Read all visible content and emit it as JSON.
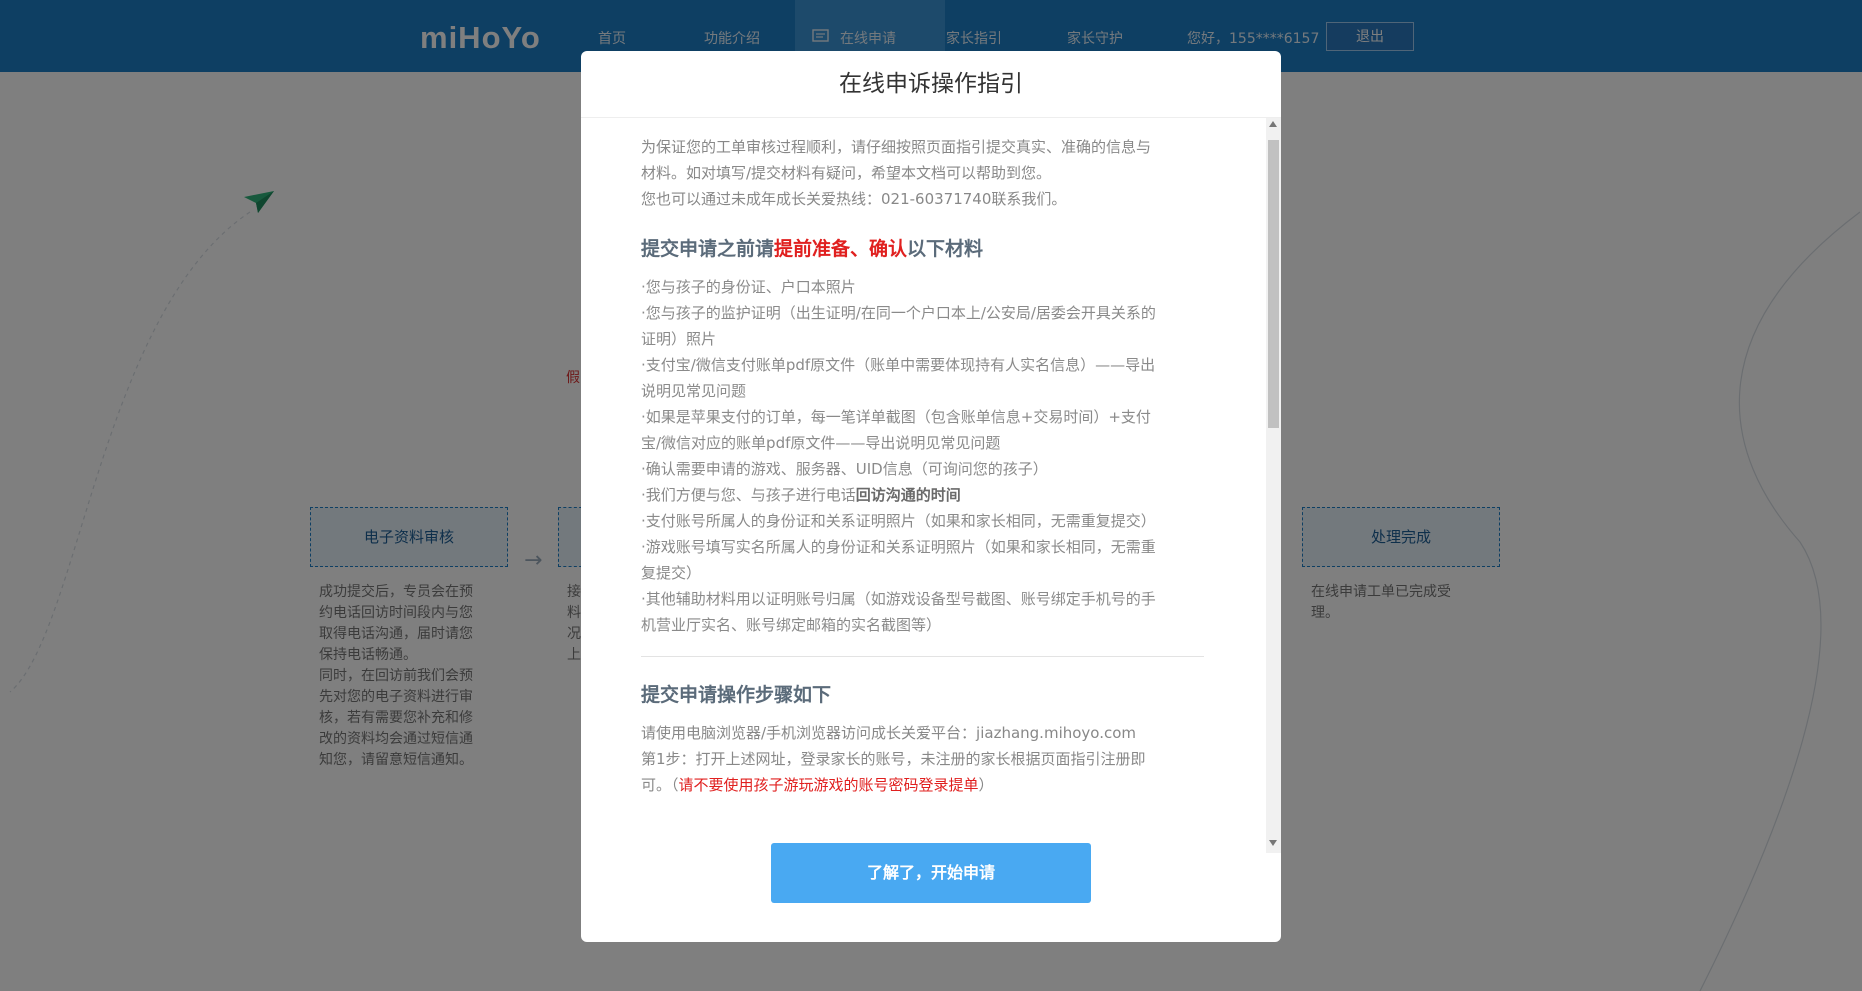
{
  "header": {
    "logo": "miHoYo",
    "nav": [
      "首页",
      "功能介绍",
      "在线申请",
      "家长指引",
      "家长守护"
    ],
    "greeting": "您好，155****6157",
    "logout": "退出"
  },
  "background": {
    "steps": [
      {
        "title": "电子资料审核",
        "desc": [
          "成功提交后，专员会在预",
          "约电话回访时间段内与您",
          "取得电话沟通，届时请您",
          "保持电话畅通。",
          "同时，在回访前我们会预",
          "先对您的电子资料进行审",
          "核，若有需要您补充和修",
          "改的资料均会通过短信通",
          "知您，请留意短信通知。"
        ]
      },
      {
        "title": "",
        "desc": [
          "接",
          "料",
          "况",
          "上"
        ]
      },
      {
        "title": "处理完成",
        "desc": [
          "在线申请工单已完成受",
          "理。"
        ]
      }
    ],
    "side_mark": "假"
  },
  "modal": {
    "title": "在线申诉操作指引",
    "intro": [
      "为保证您的工单审核过程顺利，请仔细按照页面指引提交真实、准确的信息与",
      "材料。如对填写/提交材料有疑问，希望本文档可以帮助到您。",
      "您也可以通过未成年成长关爱热线：021-60371740联系我们。"
    ],
    "section1": {
      "part1": "提交申请之前请",
      "part2": "提前准备、确认",
      "part3": "以下材料"
    },
    "bullets": [
      "·您与孩子的身份证、户口本照片",
      "·您与孩子的监护证明（出生证明/在同一个户口本上/公安局/居委会开具关系的",
      "证明）照片",
      "·支付宝/微信支付账单pdf原文件（账单中需要体现持有人实名信息）——导出",
      "说明见常见问题",
      "·如果是苹果支付的订单，每一笔详单截图（包含账单信息+交易时间）+支付",
      "宝/微信对应的账单pdf原文件——导出说明见常见问题",
      "·确认需要申请的游戏、服务器、UID信息（可询问您的孩子）"
    ],
    "bullet_callback": {
      "prefix": "·我们方便与您、与孩子进行电话",
      "bold": "回访沟通的时间"
    },
    "bullets2": [
      "·支付账号所属人的身份证和关系证明照片（如果和家长相同，无需重复提交）",
      "·游戏账号填写实名所属人的身份证和关系证明照片（如果和家长相同，无需重",
      "复提交）",
      "·其他辅助材料用以证明账号归属（如游戏设备型号截图、账号绑定手机号的手",
      "机营业厅实名、账号绑定邮箱的实名截图等）"
    ],
    "section2": "提交申请操作步骤如下",
    "steps_text": [
      "请使用电脑浏览器/手机浏览器访问成长关爱平台：jiazhang.mihoyo.com",
      "第1步：打开上述网址，登录家长的账号，未注册的家长根据页面指引注册即"
    ],
    "step1_tail": {
      "prefix": "可。（",
      "red": "请不要使用孩子游玩游戏的账号密码登录提单",
      "suffix": "）"
    },
    "confirm": "了解了，开始申请"
  }
}
